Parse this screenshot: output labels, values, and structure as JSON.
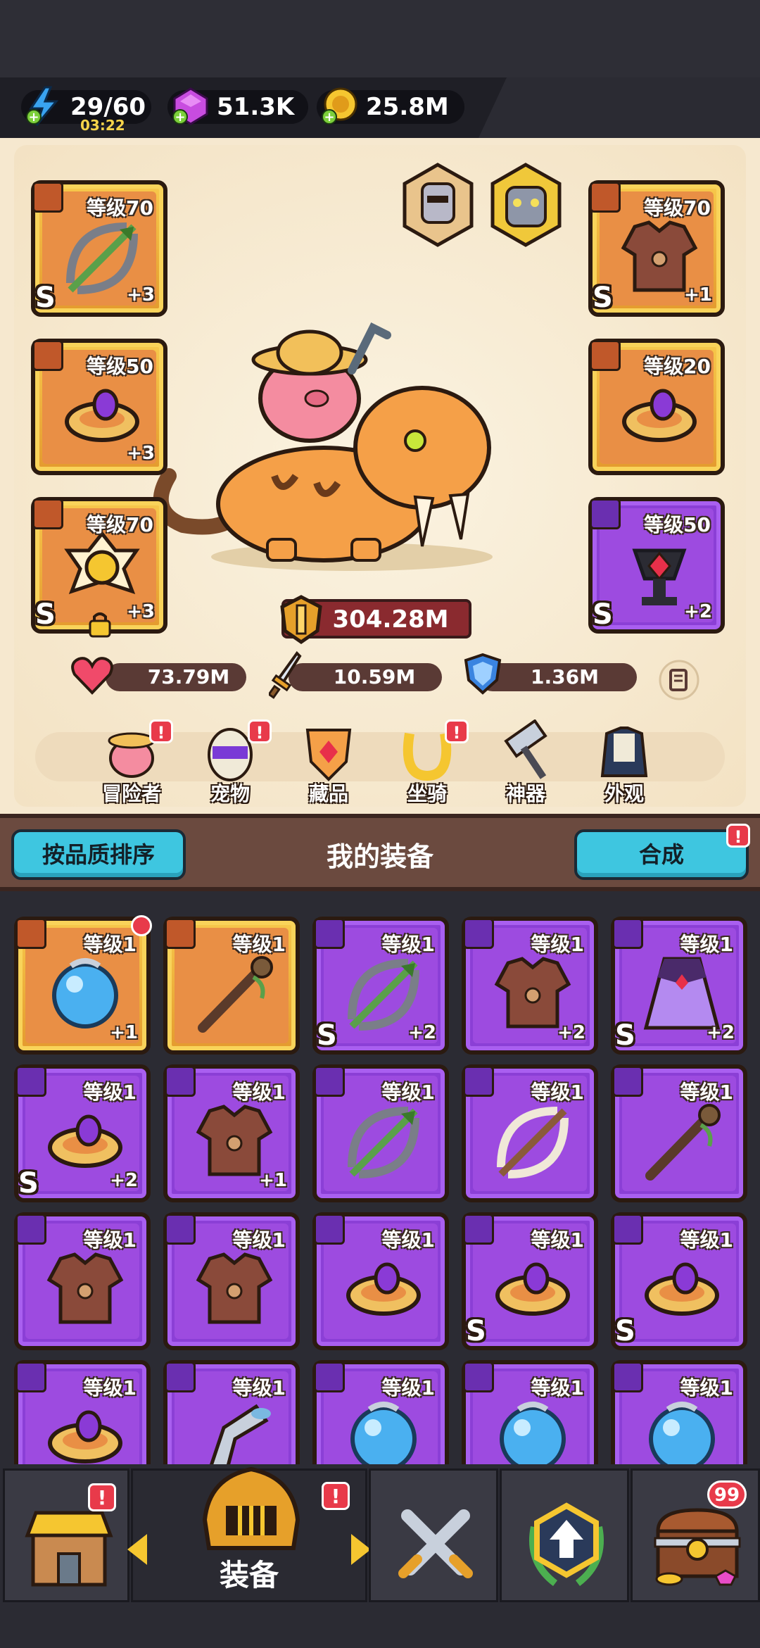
{
  "resources": {
    "energy": "29/60",
    "energy_timer": "03:22",
    "gems": "51.3K",
    "coins": "25.8M"
  },
  "equipped": {
    "left": [
      {
        "level": "等级70",
        "plus": "+3",
        "grade": "S",
        "frame": "gold",
        "icon": "bow-icon"
      },
      {
        "level": "等级50",
        "plus": "+3",
        "grade": "",
        "frame": "gold",
        "icon": "ring-icon"
      },
      {
        "level": "等级70",
        "plus": "+3",
        "grade": "S",
        "frame": "gold",
        "icon": "medal-icon"
      }
    ],
    "right": [
      {
        "level": "等级70",
        "plus": "+1",
        "grade": "S",
        "frame": "gold",
        "icon": "armor-icon"
      },
      {
        "level": "等级20",
        "plus": "",
        "grade": "",
        "frame": "gold",
        "icon": "ring-icon"
      },
      {
        "level": "等级50",
        "plus": "+2",
        "grade": "S",
        "frame": "purple",
        "icon": "amulet-icon"
      }
    ]
  },
  "power": "304.28M",
  "stats": {
    "hp": "73.79M",
    "attack": "10.59M",
    "defense": "1.36M"
  },
  "categories": [
    {
      "label": "冒险者",
      "alert": true
    },
    {
      "label": "宠物",
      "alert": true
    },
    {
      "label": "藏品",
      "alert": false
    },
    {
      "label": "坐骑",
      "alert": true
    },
    {
      "label": "神器",
      "alert": false
    },
    {
      "label": "外观",
      "alert": false
    }
  ],
  "equipment_panel": {
    "sort_button": "按品质排序",
    "title": "我的装备",
    "merge_button": "合成",
    "alert": "!"
  },
  "inventory": [
    {
      "level": "等级1",
      "plus": "+1",
      "grade": "",
      "frame": "gold",
      "icon": "orb-icon"
    },
    {
      "level": "等级1",
      "plus": "",
      "grade": "",
      "frame": "gold",
      "icon": "staff-icon"
    },
    {
      "level": "等级1",
      "plus": "+2",
      "grade": "S",
      "frame": "purple",
      "icon": "bow-icon"
    },
    {
      "level": "等级1",
      "plus": "+2",
      "grade": "",
      "frame": "purple",
      "icon": "armor-icon"
    },
    {
      "level": "等级1",
      "plus": "+2",
      "grade": "S",
      "frame": "purple",
      "icon": "cloak-icon"
    },
    {
      "level": "等级1",
      "plus": "+2",
      "grade": "S",
      "frame": "purple",
      "icon": "ring-icon"
    },
    {
      "level": "等级1",
      "plus": "+1",
      "grade": "",
      "frame": "purple",
      "icon": "armor-icon"
    },
    {
      "level": "等级1",
      "plus": "",
      "grade": "",
      "frame": "purple",
      "icon": "bow-icon"
    },
    {
      "level": "等级1",
      "plus": "",
      "grade": "",
      "frame": "purple",
      "icon": "bone-bow-icon"
    },
    {
      "level": "等级1",
      "plus": "",
      "grade": "",
      "frame": "purple",
      "icon": "staff-icon"
    },
    {
      "level": "等级1",
      "plus": "",
      "grade": "",
      "frame": "purple",
      "icon": "armor-icon"
    },
    {
      "level": "等级1",
      "plus": "",
      "grade": "",
      "frame": "purple",
      "icon": "armor-icon"
    },
    {
      "level": "等级1",
      "plus": "",
      "grade": "",
      "frame": "purple",
      "icon": "ring-icon"
    },
    {
      "level": "等级1",
      "plus": "",
      "grade": "S",
      "frame": "purple",
      "icon": "ring-icon"
    },
    {
      "level": "等级1",
      "plus": "",
      "grade": "S",
      "frame": "purple",
      "icon": "ring-icon"
    },
    {
      "level": "等级1",
      "plus": "",
      "grade": "",
      "frame": "purple",
      "icon": "ring-icon"
    },
    {
      "level": "等级1",
      "plus": "",
      "grade": "",
      "frame": "purple",
      "icon": "horn-icon"
    },
    {
      "level": "等级1",
      "plus": "",
      "grade": "",
      "frame": "purple",
      "icon": "orb-icon"
    },
    {
      "level": "等级1",
      "plus": "",
      "grade": "",
      "frame": "purple",
      "icon": "orb-icon"
    },
    {
      "level": "等级1",
      "plus": "",
      "grade": "",
      "frame": "purple",
      "icon": "orb-icon"
    }
  ],
  "bottom_nav": {
    "active_label": "装备",
    "chest_count": "99",
    "alert": "!"
  },
  "colors": {
    "gold_frame": "#f7c84b",
    "purple_frame": "#8b3fd6",
    "accent_cyan": "#3ec6e0",
    "alert_red": "#e83a4a"
  }
}
